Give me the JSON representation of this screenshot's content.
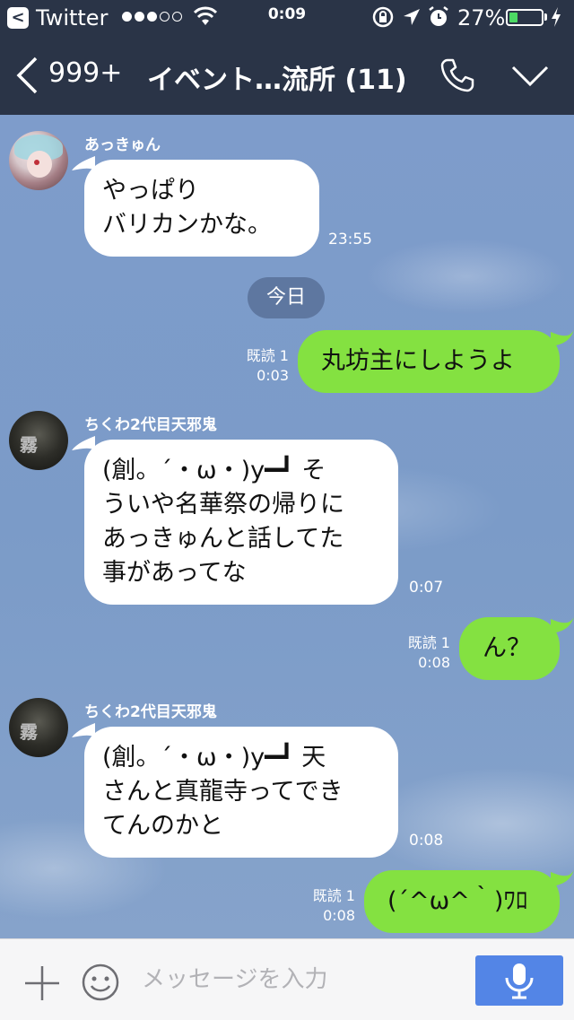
{
  "status_bar": {
    "back_app_badge": "<",
    "carrier": "Twitter",
    "time": "0:09",
    "battery_percent": "27%",
    "battery_level": 0.27,
    "battery_color": "#4cd964",
    "icons": [
      "back-to-app-icon",
      "signal-dots-icon",
      "wifi-icon",
      "rotation-lock-icon",
      "location-arrow-icon",
      "alarm-icon",
      "battery-icon",
      "charging-bolt-icon"
    ]
  },
  "nav": {
    "back_count": "999+",
    "title": "イベント…流所 (11)",
    "icons": [
      "back-chevron-icon",
      "phone-icon",
      "chevron-down-icon"
    ]
  },
  "messages": [
    {
      "sender": "あっきゅん",
      "text": "やっぱり\nバリカンかな。",
      "time": "23:55"
    },
    {
      "date_divider": "今日"
    },
    {
      "read": "既読 1",
      "time": "0:03",
      "text": "丸坊主にしようよ"
    },
    {
      "sender": "ちくわ2代目天邪鬼",
      "text": "(創。´・ω・)y━┛ そ\nういや名華祭の帰りに\nあっきゅんと話してた\n事があってな",
      "time": "0:07"
    },
    {
      "read": "既読 1",
      "time": "0:08",
      "text": "ん？"
    },
    {
      "sender": "ちくわ2代目天邪鬼",
      "text": "(創。´・ω・)y━┛ 天\nさんと真龍寺ってでき\nてんのかと",
      "time": "0:08"
    },
    {
      "read": "既読 1",
      "time": "0:08",
      "text": "(´^ω^｀)ﾜﾛﾁ"
    }
  ],
  "colors": {
    "header": "#2a3447",
    "bubble_out": "#84e141",
    "bubble_in": "#ffffff",
    "mic_button": "#5385e6"
  },
  "input": {
    "placeholder": "メッセージを入力",
    "icons": [
      "plus-icon",
      "smiley-icon",
      "microphone-icon"
    ]
  }
}
